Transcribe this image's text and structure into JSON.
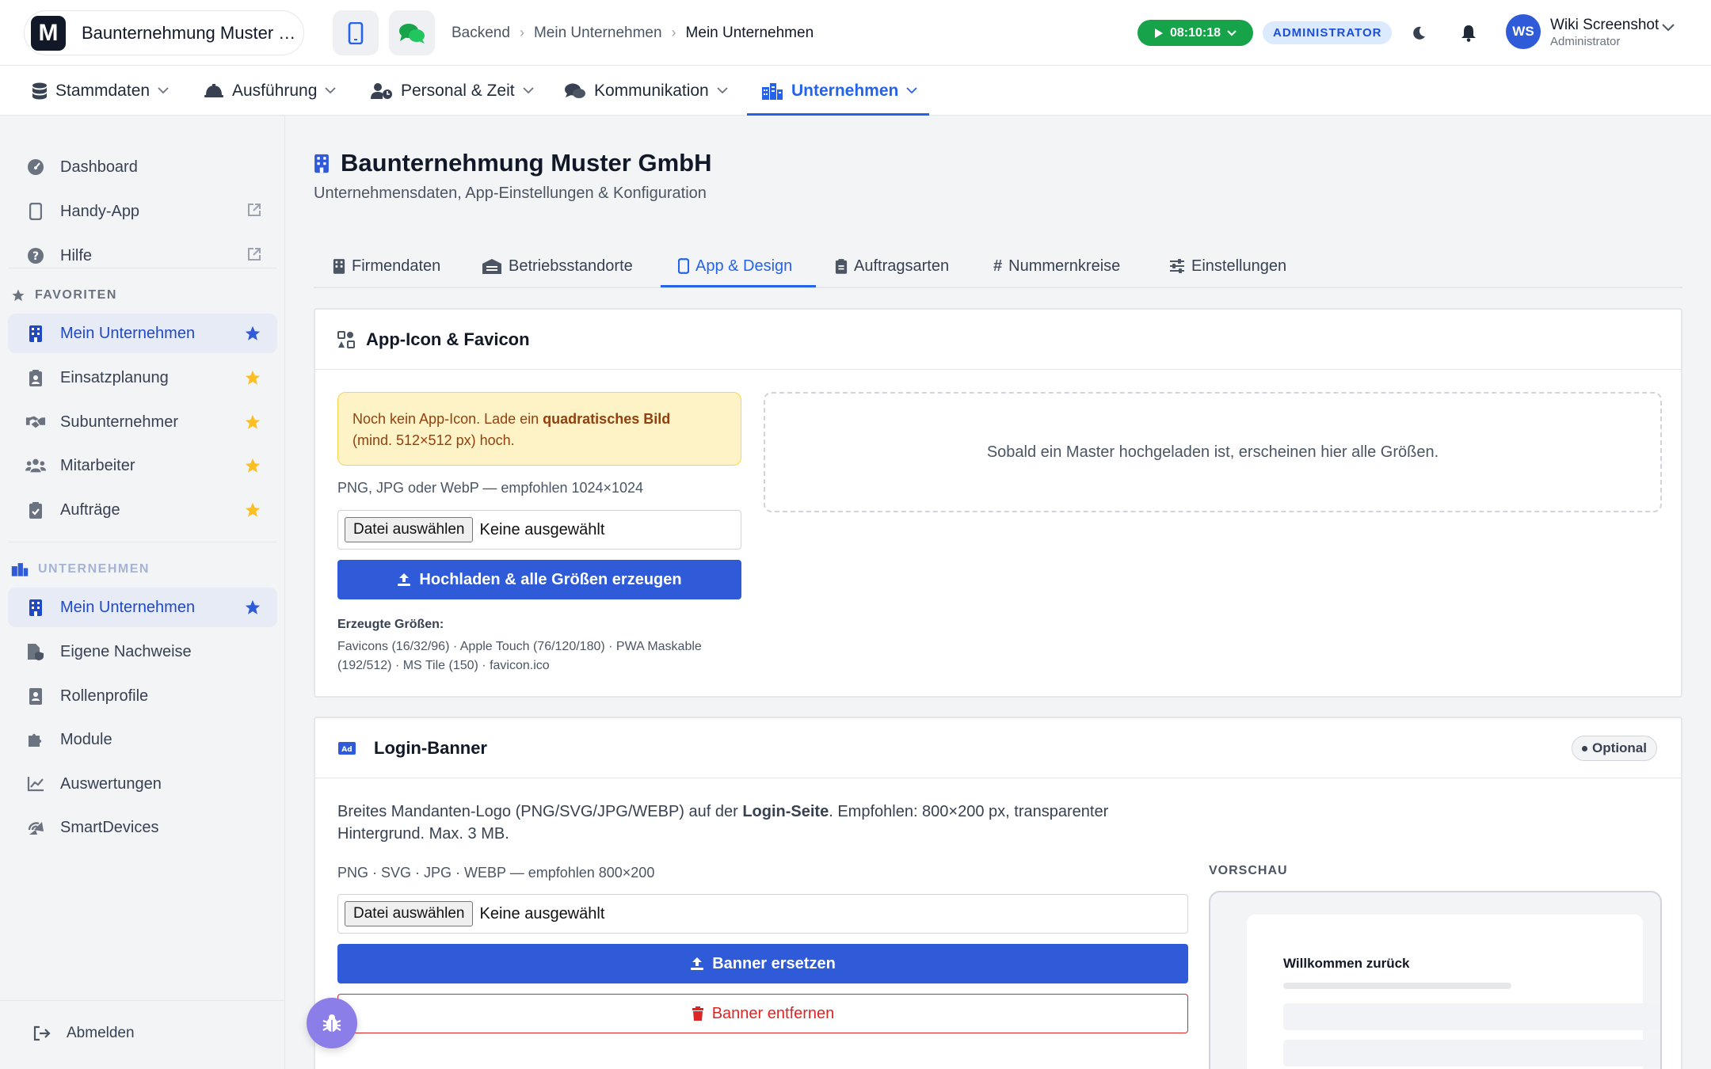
{
  "header": {
    "company_name": "Baunternehmung Muster G...",
    "logo_letter": "M",
    "breadcrumb": [
      "Backend",
      "Mein Unternehmen",
      "Mein Unternehmen"
    ],
    "timer": "08:10:18",
    "role_badge": "ADMINISTRATOR",
    "user_initials": "WS",
    "user_name": "Wiki Screenshot",
    "user_role": "Administrator"
  },
  "mainnav": {
    "items": [
      {
        "label": "Stammdaten",
        "icon": "database-icon"
      },
      {
        "label": "Ausführung",
        "icon": "helmet-icon"
      },
      {
        "label": "Personal & Zeit",
        "icon": "user-clock-icon"
      },
      {
        "label": "Kommunikation",
        "icon": "comments-icon"
      },
      {
        "label": "Unternehmen",
        "icon": "city-icon",
        "active": true
      }
    ]
  },
  "sidebar": {
    "top": [
      {
        "label": "Dashboard",
        "icon": "gauge-icon"
      },
      {
        "label": "Handy-App",
        "icon": "mobile-icon",
        "external": true
      },
      {
        "label": "Hilfe",
        "icon": "question-icon",
        "external": true
      }
    ],
    "favorites_heading": "FAVORITEN",
    "favorites": [
      {
        "label": "Mein Unternehmen",
        "active": true
      },
      {
        "label": "Einsatzplanung"
      },
      {
        "label": "Subunternehmer"
      },
      {
        "label": "Mitarbeiter"
      },
      {
        "label": "Aufträge"
      }
    ],
    "section_heading": "UNTERNEHMEN",
    "section": [
      {
        "label": "Mein Unternehmen",
        "active": true
      },
      {
        "label": "Eigene Nachweise"
      },
      {
        "label": "Rollenprofile"
      },
      {
        "label": "Module"
      },
      {
        "label": "Auswertungen"
      },
      {
        "label": "SmartDevices"
      }
    ],
    "logout": "Abmelden"
  },
  "page": {
    "title": "Baunternehmung Muster GmbH",
    "subtitle": "Unternehmensdaten, App-Einstellungen & Konfiguration",
    "tabs": [
      "Firmendaten",
      "Betriebsstandorte",
      "App & Design",
      "Auftragsarten",
      "Nummernkreise",
      "Einstellungen"
    ],
    "active_tab": "App & Design"
  },
  "app_icon_card": {
    "title": "App-Icon & Favicon",
    "warning_pre": "Noch kein App-Icon. Lade ein ",
    "warning_bold": "quadratisches Bild",
    "warning_post": "(mind. 512×512 px) hoch.",
    "file_hint": "PNG, JPG oder WebP — empfohlen 1024×1024",
    "file_button": "Datei auswählen",
    "file_status": "Keine ausgewählt",
    "upload_button": "Hochladen & alle Größen erzeugen",
    "sizes_title": "Erzeugte Größen:",
    "sizes_text": "Favicons (16/32/96) · Apple Touch (76/120/180) · PWA Maskable (192/512) · MS Tile (150) · favicon.ico",
    "placeholder": "Sobald ein Master hochgeladen ist, erscheinen hier alle Größen."
  },
  "banner_card": {
    "title": "Login-Banner",
    "badge": "Optional",
    "desc_pre": "Breites Mandanten-Logo (PNG/SVG/JPG/WEBP) auf der ",
    "desc_bold": "Login-Seite",
    "desc_post": ". Empfohlen: 800×200 px, transparenter Hintergrund. Max. 3 MB.",
    "file_hint": "PNG · SVG · JPG · WEBP — empfohlen 800×200",
    "file_button": "Datei auswählen",
    "file_status": "Keine ausgewählt",
    "replace_button": "Banner ersetzen",
    "remove_button": "Banner entfernen",
    "preview_label": "VORSCHAU",
    "preview_title": "Willkommen zurück"
  },
  "colors": {
    "primary": "#2f5bd8",
    "accent": "#2563eb",
    "success": "#16a34a",
    "danger": "#dc2626",
    "star": "#fbbf24"
  }
}
